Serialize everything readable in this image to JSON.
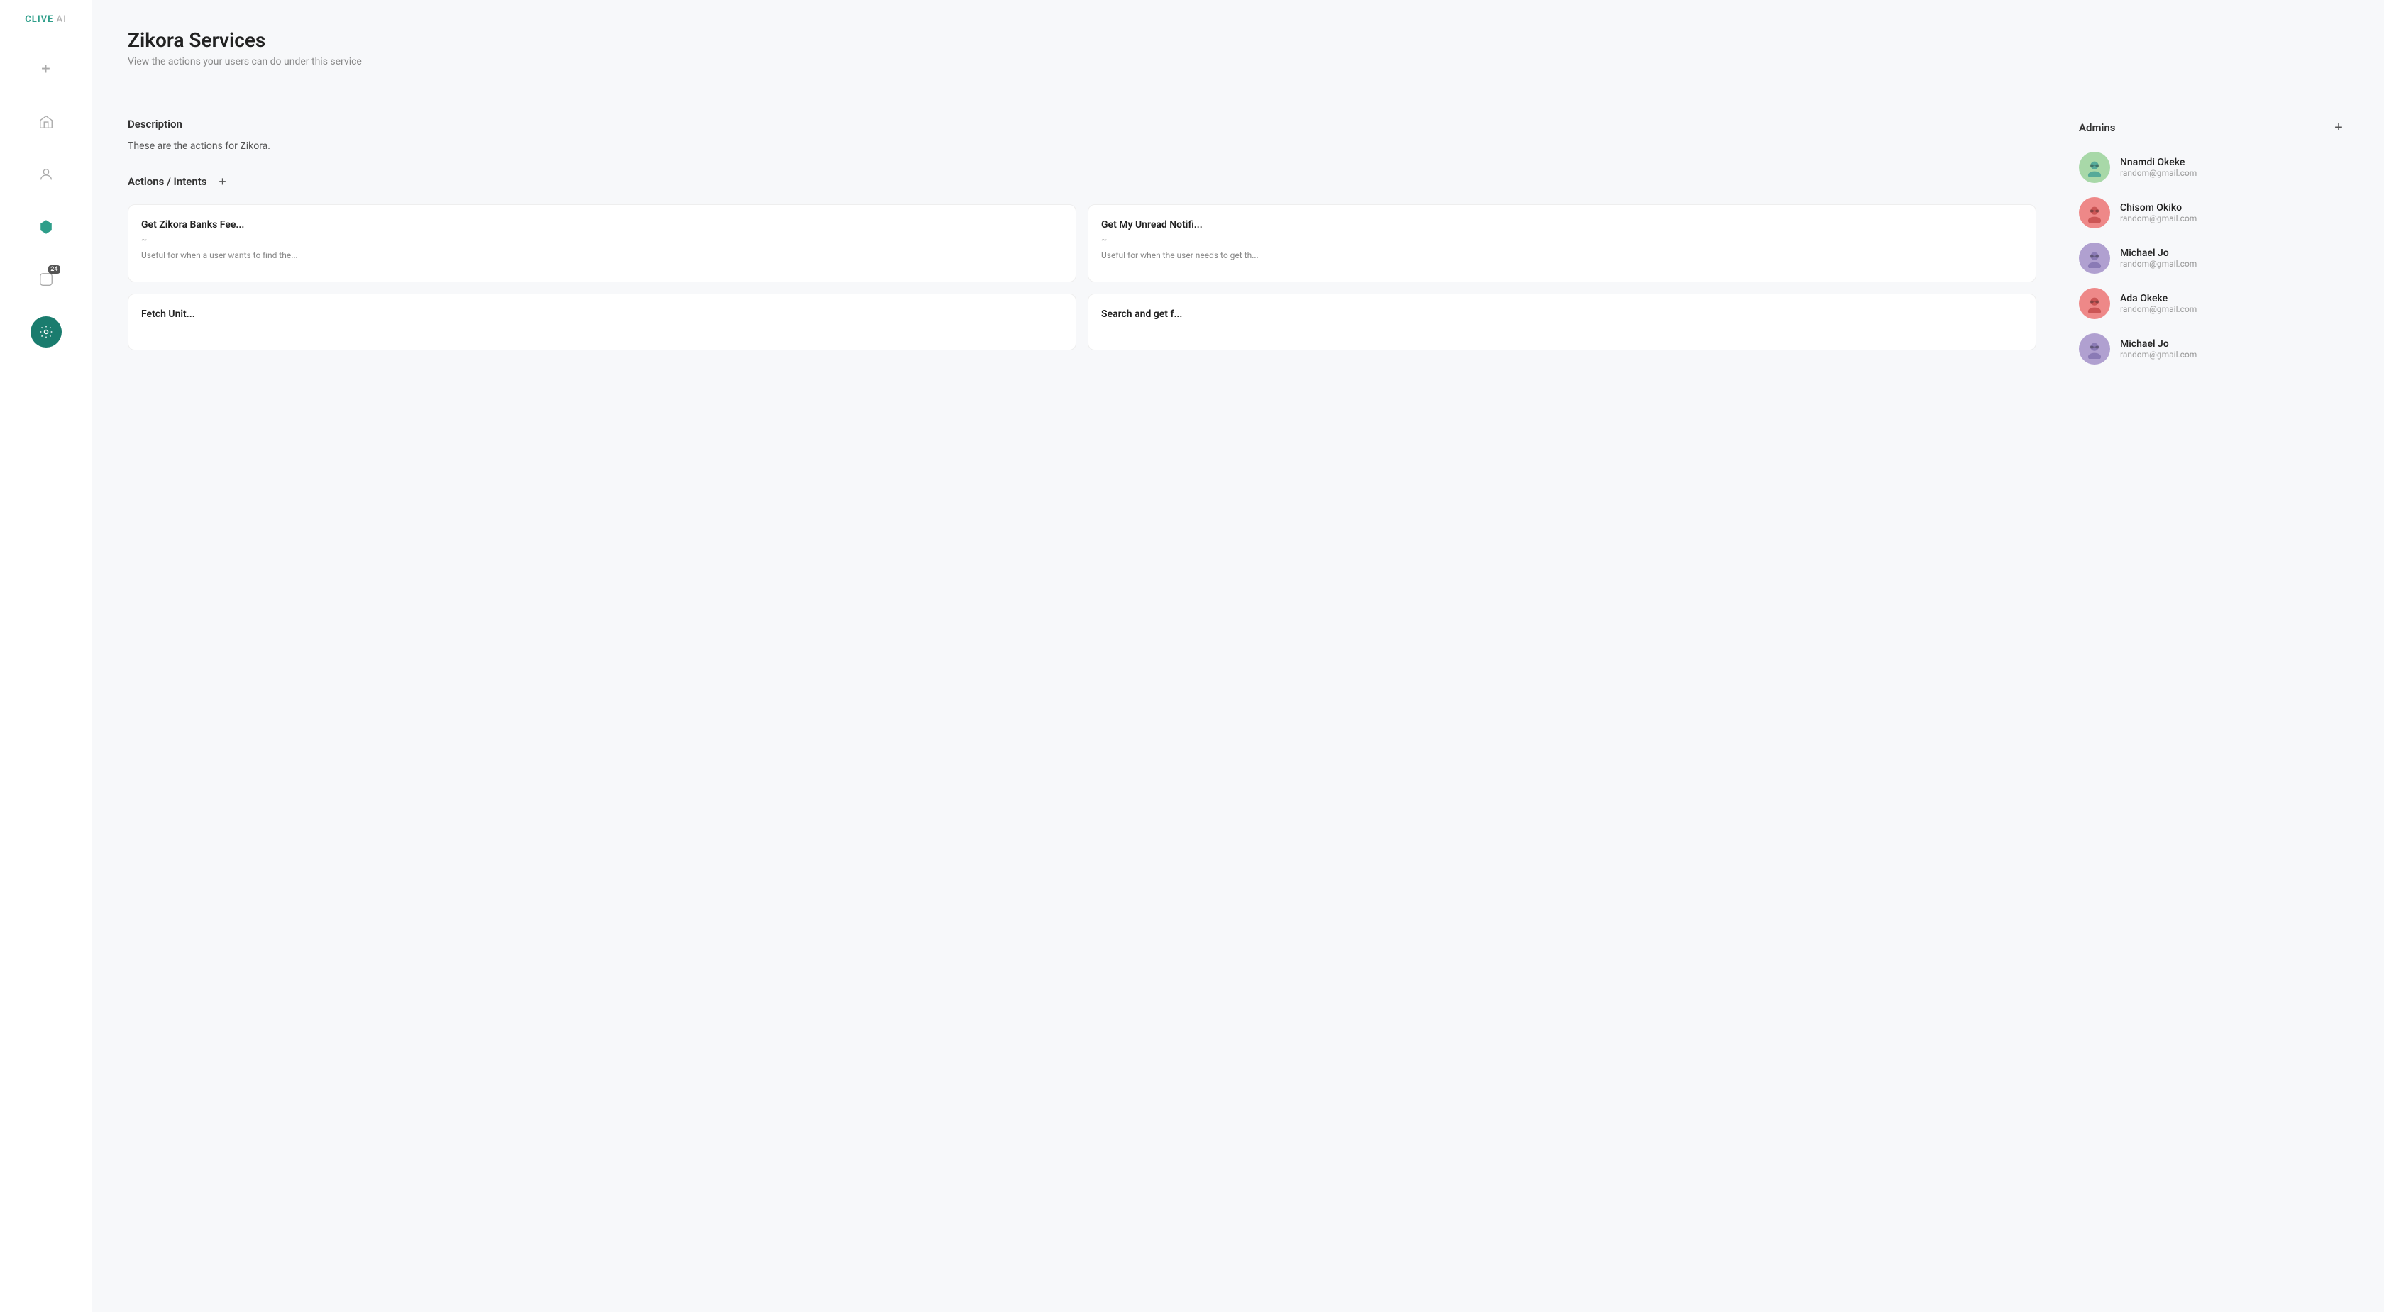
{
  "logo": {
    "brand": "CLIVE",
    "suffix": "AI"
  },
  "sidebar": {
    "icons": [
      {
        "name": "add-icon",
        "symbol": "+",
        "interactable": true,
        "active": false
      },
      {
        "name": "home-icon",
        "symbol": "⌂",
        "interactable": true,
        "active": false
      },
      {
        "name": "user-icon",
        "symbol": "☻",
        "interactable": true,
        "active": false
      },
      {
        "name": "hexagon-icon",
        "symbol": "⬡",
        "interactable": true,
        "active": false,
        "activeTeal": true
      },
      {
        "name": "badge-icon",
        "symbol": "✉",
        "badge": "24",
        "interactable": true,
        "active": false
      },
      {
        "name": "settings-icon",
        "symbol": "⚙",
        "interactable": true,
        "active": true
      }
    ]
  },
  "page": {
    "title": "Zikora Services",
    "subtitle": "View the actions your users can do under this service"
  },
  "description": {
    "label": "Description",
    "text": "These are the actions for Zikora."
  },
  "actions": {
    "label": "Actions / Intents",
    "add_label": "+",
    "cards": [
      {
        "title": "Get Zikora Banks Fee...",
        "tilde": "~",
        "desc": "Useful for when a user wants to find the..."
      },
      {
        "title": "Get My Unread Notifi...",
        "tilde": "~",
        "desc": "Useful for when the user needs to get th..."
      },
      {
        "title": "Fetch Unit...",
        "tilde": "",
        "desc": ""
      },
      {
        "title": "Search and get f...",
        "tilde": "",
        "desc": ""
      }
    ]
  },
  "admins": {
    "label": "Admins",
    "add_label": "+",
    "items": [
      {
        "name": "Nnamdi Okeke",
        "email": "random@gmail.com",
        "avatar_color": "green",
        "avatar_emoji": "😎"
      },
      {
        "name": "Chisom Okiko",
        "email": "random@gmail.com",
        "avatar_color": "red",
        "avatar_emoji": "😎"
      },
      {
        "name": "Michael Jo",
        "email": "random@gmail.com",
        "avatar_color": "purple",
        "avatar_emoji": "😎"
      },
      {
        "name": "Ada Okeke",
        "email": "random@gmail.com",
        "avatar_color": "red",
        "avatar_emoji": "😎"
      },
      {
        "name": "Michael Jo",
        "email": "random@gmail.com",
        "avatar_color": "purple",
        "avatar_emoji": "😎"
      }
    ]
  }
}
